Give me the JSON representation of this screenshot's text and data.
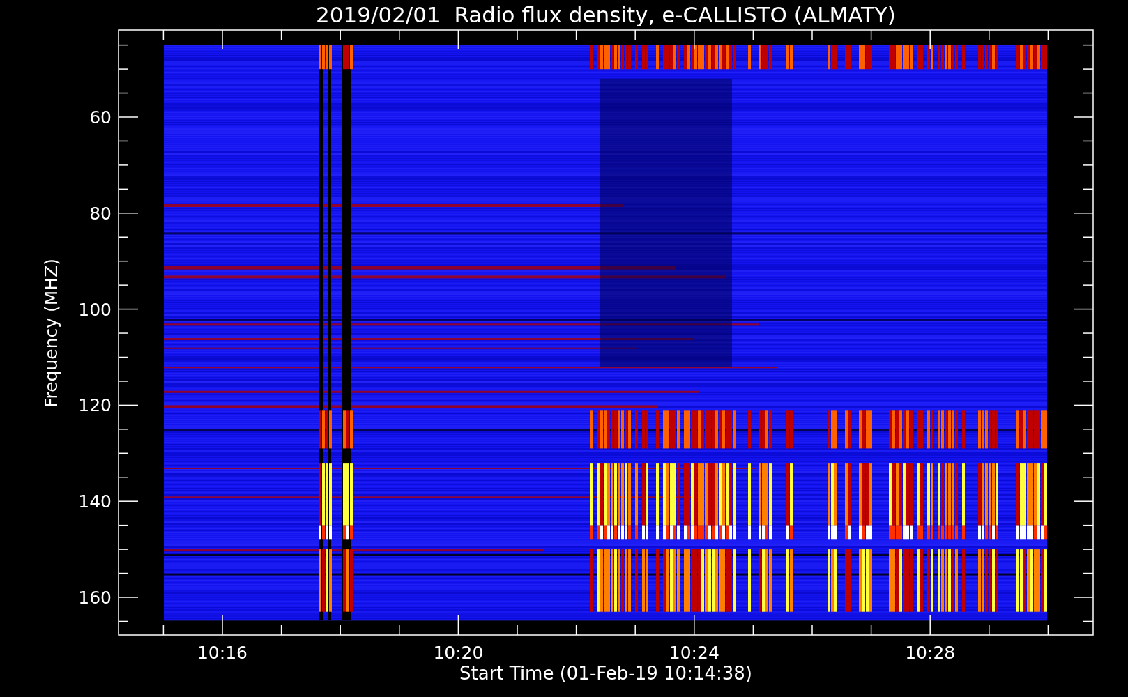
{
  "title": "2019/02/01  Radio flux density, e-CALLISTO (ALMATY)",
  "xlabel": "Start Time (01-Feb-19 10:14:38)",
  "ylabel": "Frequency (MHZ)",
  "xticks": [
    "10:16",
    "10:20",
    "10:24",
    "10:28"
  ],
  "yticks": [
    "60",
    "80",
    "100",
    "120",
    "140",
    "160"
  ]
}
